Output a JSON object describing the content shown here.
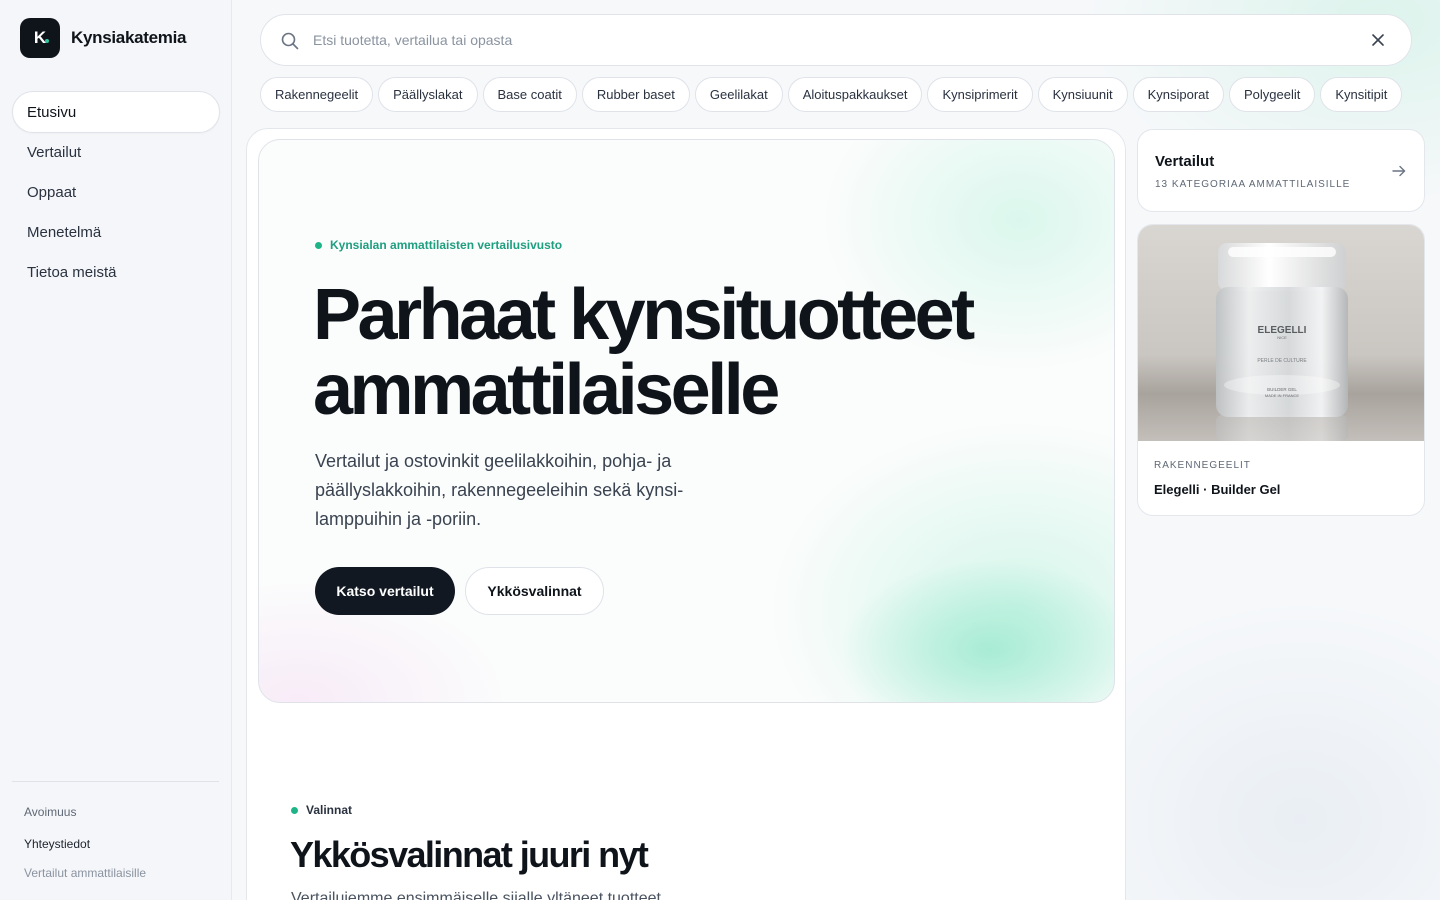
{
  "brand": {
    "logo_letter": "K",
    "name": "Kynsiakatemia"
  },
  "nav": {
    "items": [
      {
        "label": "Etusivu",
        "active": true
      },
      {
        "label": "Vertailut",
        "active": false
      },
      {
        "label": "Oppaat",
        "active": false
      },
      {
        "label": "Menetelmä",
        "active": false
      },
      {
        "label": "Tietoa meistä",
        "active": false
      }
    ]
  },
  "footer": {
    "openness": "Avoimuus",
    "contact": "Yhteystiedot",
    "tagline": "Vertailut ammattilaisille"
  },
  "search": {
    "placeholder": "Etsi tuotetta, vertailua tai opasta",
    "value": ""
  },
  "chips": [
    "Rakennegeelit",
    "Päällyslakat",
    "Base coatit",
    "Rubber baset",
    "Geelilakat",
    "Aloituspakkaukset",
    "Kynsiprimerit",
    "Kynsiuunit",
    "Kynsiporat",
    "Polygeelit",
    "Kynsitipit"
  ],
  "hero": {
    "eyebrow": "Kynsialan ammattilaisten vertailusivusto",
    "title": "Parhaat kynsituot­teet ammattilaiselle",
    "subtitle": "Vertailut ja ostovinkit geelilakkoihin, pohja- ja päällyslakkoihin, rakennegeeleihin sekä kynsi­lamppuihin ja -poriin.",
    "primary_button": "Katso vertailut",
    "secondary_button": "Ykkösvalinnat"
  },
  "section": {
    "eyebrow": "Valinnat",
    "title": "Ykkösvalinnat juuri nyt",
    "subtitle": "Vertailujemme ensimmäiselle sijalle yltäneet tuotteet."
  },
  "comparisons_card": {
    "title": "Vertailut",
    "subtitle": "13 KATEGORIAA AMMATTILAISILLE"
  },
  "product_card": {
    "category": "RAKENNEGEELIT",
    "name": "Elegelli · Builder Gel",
    "jar_brand": "ELEGELLI",
    "jar_sub": "NICE",
    "jar_line": "PERLE DE CULTURE",
    "jar_product": "BUILDER GEL",
    "jar_origin": "MADE IN FRANCE"
  },
  "colors": {
    "accent": "#1fb488",
    "dark": "#121821"
  }
}
